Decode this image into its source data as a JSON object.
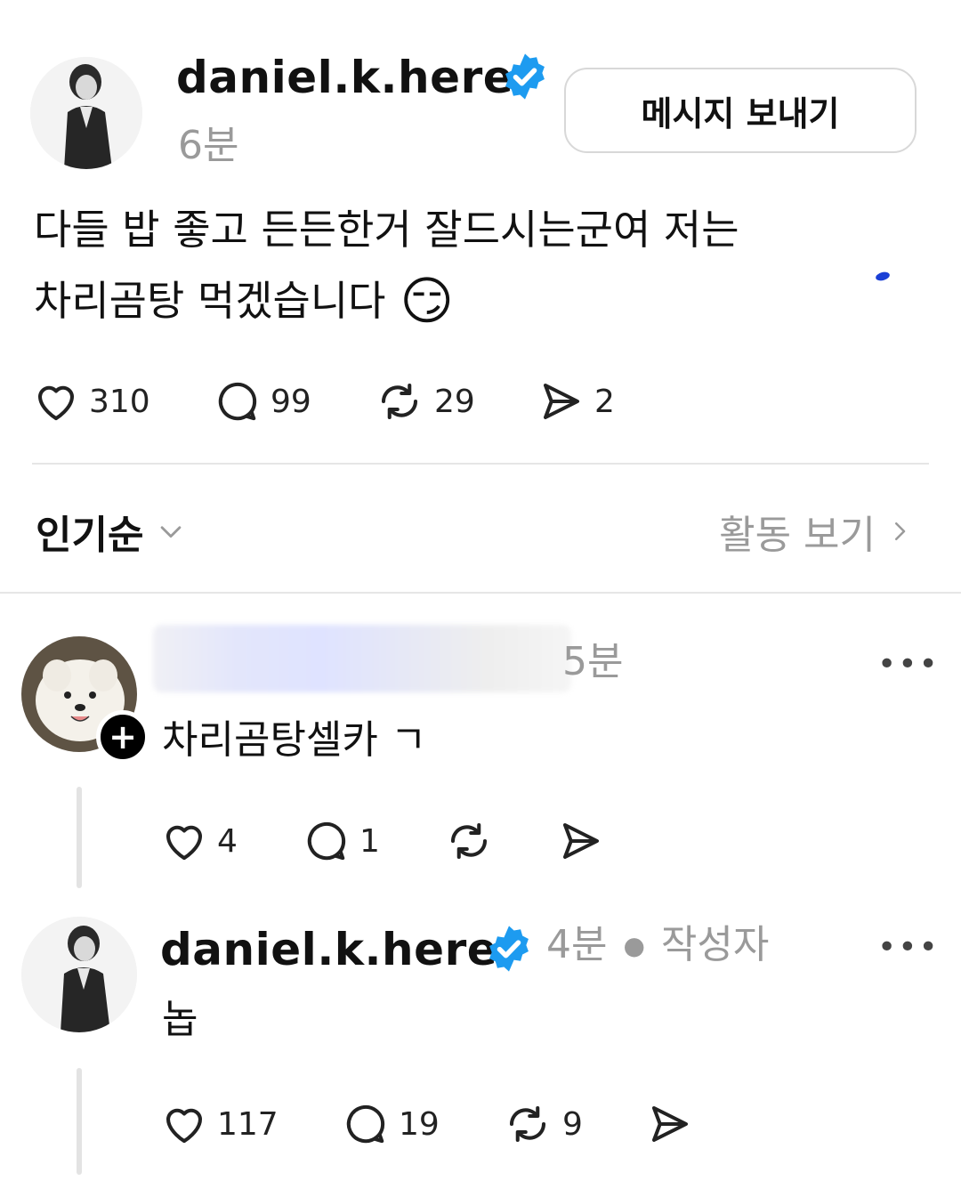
{
  "post": {
    "username": "daniel.k.here",
    "time": "6분",
    "message_button": "메시지 보내기",
    "text_line1": "다들 밥 좋고 든든한거 잘드시는군여 저는",
    "text_line2": "차리곰탕 먹겠습니다",
    "emoji": "😏",
    "likes": "310",
    "comments": "99",
    "reposts": "29",
    "shares": "2"
  },
  "sort_bar": {
    "sort_label": "인기순",
    "activity_label": "활동 보기"
  },
  "replies": [
    {
      "time": "5분",
      "text": "차리곰탕셀카 ㄱ",
      "likes": "4",
      "comments": "1",
      "reposts": "",
      "shares": ""
    },
    {
      "username": "daniel.k.here",
      "time": "4분",
      "author_tag": "작성자",
      "text": "놉",
      "likes": "117",
      "comments": "19",
      "reposts": "9",
      "shares": ""
    }
  ],
  "colors": {
    "verified": "#1d9bf0",
    "muted": "#9a9a9a",
    "divider": "#e6e6e6"
  },
  "icons": [
    "heart-icon",
    "comment-icon",
    "repost-icon",
    "send-icon",
    "verified-icon",
    "chevron-down-icon",
    "chevron-right-icon",
    "more-icon",
    "plus-icon"
  ]
}
